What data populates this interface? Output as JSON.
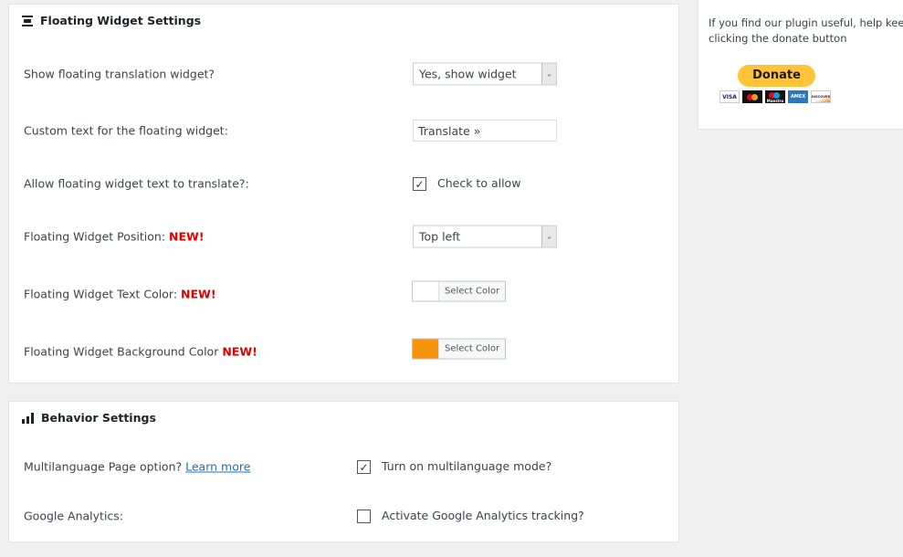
{
  "floating": {
    "title": "Floating Widget Settings",
    "icon": "widget-icon",
    "show_label": "Show floating translation widget?",
    "show_value": "Yes, show widget",
    "text_label": "Custom text for the floating widget:",
    "text_value": "Translate »",
    "allow_label": "Allow floating widget text to translate?:",
    "allow_text": "Check to allow",
    "allow_checked": true,
    "pos_label": "Floating Widget Position: ",
    "pos_value": "Top left",
    "tcolor_label": "Floating Widget Text Color: ",
    "tcolor": "#ffffff",
    "bgcolor_label": "Floating Widget Background Color ",
    "bgcolor": "#f7940c",
    "new": "NEW!",
    "select_color": "Select Color"
  },
  "behavior": {
    "title": "Behavior Settings",
    "icon": "bar-chart-icon",
    "multi_label": "Multilanguage Page option?",
    "learn_more": "Learn more",
    "multi_text": "Turn on multilanguage mode?",
    "multi_checked": true,
    "ga_label": "Google Analytics:",
    "ga_text": "Activate Google Analytics tracking?",
    "ga_checked": false
  },
  "donate": {
    "text1": "If you find our plugin useful, help keep i",
    "text2": "clicking the donate button",
    "button": "Donate",
    "cards": [
      "VISA",
      "MC",
      "Maestro",
      "AMEX",
      "DISCOVER"
    ]
  }
}
